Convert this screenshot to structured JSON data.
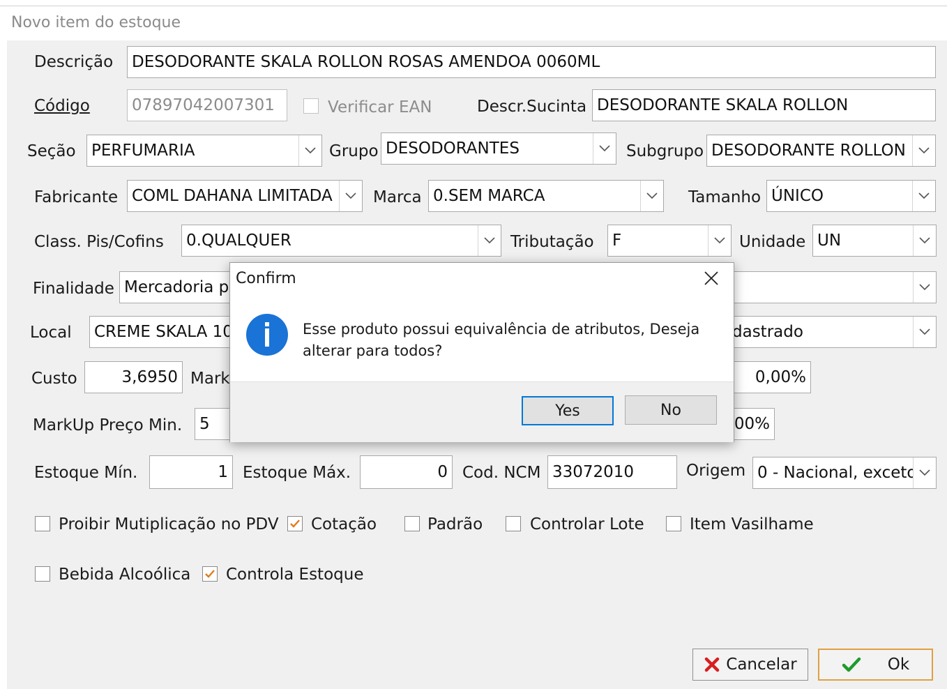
{
  "window": {
    "title": "Novo item do estoque"
  },
  "form": {
    "descricao": {
      "label": "Descrição",
      "value": "DESODORANTE SKALA ROLLON ROSAS AMENDOA 0060ML"
    },
    "codigo": {
      "label": "Código",
      "value": "07897042007301"
    },
    "verificar_ean": {
      "label": "Verificar EAN",
      "checked": false
    },
    "descr_sucinta": {
      "label": "Descr.Sucinta",
      "value": "DESODORANTE SKALA ROLLON"
    },
    "secao": {
      "label": "Seção",
      "value": "PERFUMARIA"
    },
    "grupo": {
      "label": "Grupo",
      "value": "DESODORANTES"
    },
    "subgrupo": {
      "label": "Subgrupo",
      "value": "DESODORANTE ROLLON"
    },
    "fabricante": {
      "label": "Fabricante",
      "value": "COML DAHANA LIMITADA"
    },
    "marca": {
      "label": "Marca",
      "value": "0.SEM MARCA"
    },
    "tamanho": {
      "label": "Tamanho",
      "value": "ÚNICO"
    },
    "class_pis": {
      "label": "Class. Pis/Cofins",
      "value": "0.QUALQUER"
    },
    "tributacao": {
      "label": "Tributação",
      "value": "F"
    },
    "unidade": {
      "label": "Unidade",
      "value": "UN"
    },
    "finalidade": {
      "label": "Finalidade",
      "value": "Mercadoria p"
    },
    "local": {
      "label": "Local",
      "value": "CREME SKALA 10",
      "right_value": "dastrado"
    },
    "custo": {
      "label": "Custo",
      "value": "3,6950",
      "markup_label": "Mark",
      "right_value": "0,00%"
    },
    "markup_min": {
      "label": "MarkUp Preço Min.",
      "value": "5",
      "right_value": "00%"
    },
    "estoque_min": {
      "label": "Estoque Mín.",
      "value": "1"
    },
    "estoque_max": {
      "label": "Estoque Máx.",
      "value": "0"
    },
    "cod_ncm": {
      "label": "Cod. NCM",
      "value": "33072010"
    },
    "origem": {
      "label": "Origem",
      "value": "0 - Nacional, exceto"
    },
    "checks": {
      "proibir": {
        "label": "Proibir Mutiplicação no PDV",
        "checked": false
      },
      "cotacao": {
        "label": "Cotação",
        "checked": true
      },
      "padrao": {
        "label": "Padrão",
        "checked": false
      },
      "lote": {
        "label": "Controlar Lote",
        "checked": false
      },
      "vasilhame": {
        "label": "Item Vasilhame",
        "checked": false
      },
      "bebida": {
        "label": "Bebida Alcoólica",
        "checked": false
      },
      "controla_estoque": {
        "label": "Controla Estoque",
        "checked": true
      }
    }
  },
  "buttons": {
    "cancel": "Cancelar",
    "ok": "Ok"
  },
  "dialog": {
    "title": "Confirm",
    "message": "Esse produto possui equivalência de atributos, Deseja alterar para todos?",
    "yes": "Yes",
    "no": "No"
  },
  "colors": {
    "accent": "#0078d7",
    "check": "#e07b1a",
    "info": "#1a73d6",
    "cancel_x": "#d81e1e",
    "ok_check": "#1f9a2c"
  }
}
